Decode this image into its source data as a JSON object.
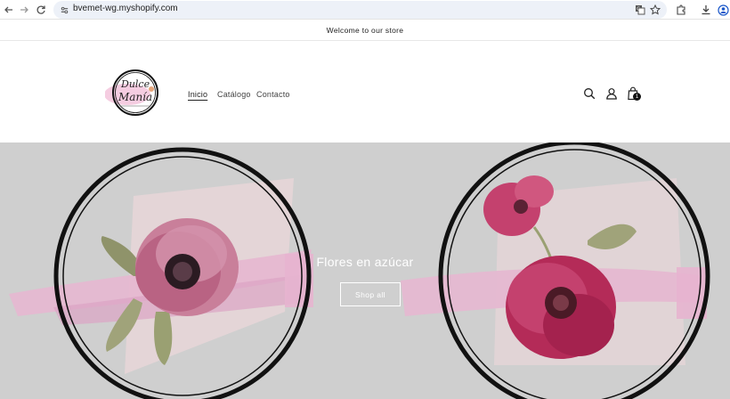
{
  "browser": {
    "url": "bvemet-wg.myshopify.com",
    "icons": [
      "back-arrow-icon",
      "forward-arrow-icon",
      "reload-icon",
      "site-info-icon",
      "translate-icon",
      "star-icon",
      "extensions-icon",
      "download-icon",
      "profile-icon"
    ]
  },
  "announcement": {
    "text": "Welcome to our store"
  },
  "header": {
    "logo_text": "Dulce Manía",
    "nav": [
      {
        "label": "Inicio",
        "active": true
      },
      {
        "label": "Catálogo",
        "active": false
      },
      {
        "label": "Contacto",
        "active": false
      }
    ],
    "cart_count": "1",
    "icons": [
      "search-icon",
      "account-icon",
      "cart-icon"
    ]
  },
  "hero": {
    "title": "Flores en azúcar",
    "button_label": "Shop all"
  },
  "colors": {
    "hero_bg": "#cfcfcf",
    "brush_pink": "#e7b4cf",
    "flower_pink": "#c4416e",
    "text_dark": "#222222"
  }
}
